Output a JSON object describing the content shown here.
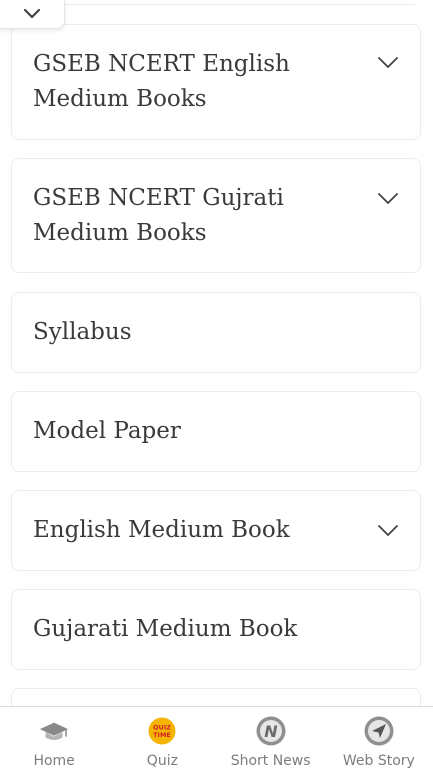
{
  "menu": {
    "items": [
      {
        "label": "GSEB NCERT English Medium Books",
        "expandable": true
      },
      {
        "label": "GSEB NCERT Gujrati Medium Books",
        "expandable": true
      },
      {
        "label": "Syllabus",
        "expandable": false
      },
      {
        "label": "Model Paper",
        "expandable": false
      },
      {
        "label": "English Medium Book",
        "expandable": true
      },
      {
        "label": "Gujarati Medium Book",
        "expandable": false
      }
    ]
  },
  "bottom_nav": {
    "items": [
      {
        "label": "Home",
        "icon": "graduation-cap-icon"
      },
      {
        "label": "Quiz",
        "icon": "quiz-time-icon",
        "badge_text": "QUIZ TIME"
      },
      {
        "label": "Short News",
        "icon": "news-n-icon",
        "badge_text": "N"
      },
      {
        "label": "Web Story",
        "icon": "send-arrow-icon"
      }
    ]
  },
  "colors": {
    "text": "#3a3a3a",
    "border": "#ececec",
    "nav_label": "#7c7c7c",
    "quiz_badge": "#f5b400"
  }
}
